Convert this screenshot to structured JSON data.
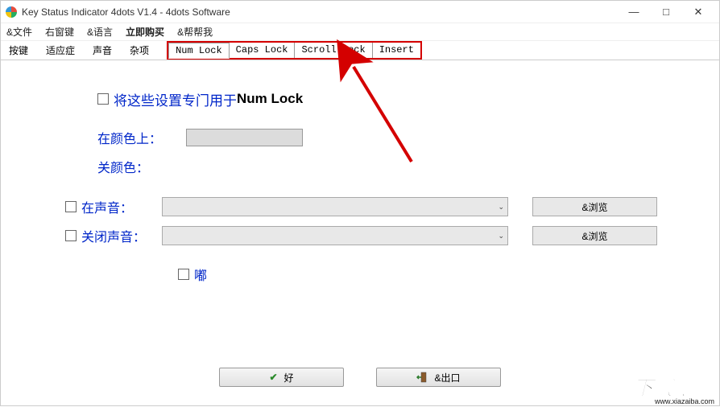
{
  "window": {
    "title": "Key Status Indicator 4dots V1.4 - 4dots Software",
    "controls": {
      "min": "—",
      "max": "□",
      "close": "✕"
    }
  },
  "menubar": {
    "items": [
      "&文件",
      "右窗键",
      "&语言",
      "立即购买",
      "&帮帮我"
    ]
  },
  "tabs": {
    "left": [
      "按键",
      "适应症",
      "声音",
      "杂项"
    ],
    "keys": [
      "Num Lock",
      "Caps Lock",
      "Scroll Lock",
      "Insert"
    ]
  },
  "settings": {
    "dedicate_prefix": "将这些设置专门用于",
    "dedicate_key": "Num Lock",
    "on_color_label": "在颜色上：",
    "off_color_label": "关颜色：",
    "on_sound_label": "在声音：",
    "off_sound_label": "关闭声音：",
    "beep_label": "嘟",
    "browse_label": "&浏览"
  },
  "buttons": {
    "ok": "好",
    "exit": "&出口"
  },
  "watermark": {
    "main": "下载吧",
    "url": "www.xiazaiba.com"
  }
}
